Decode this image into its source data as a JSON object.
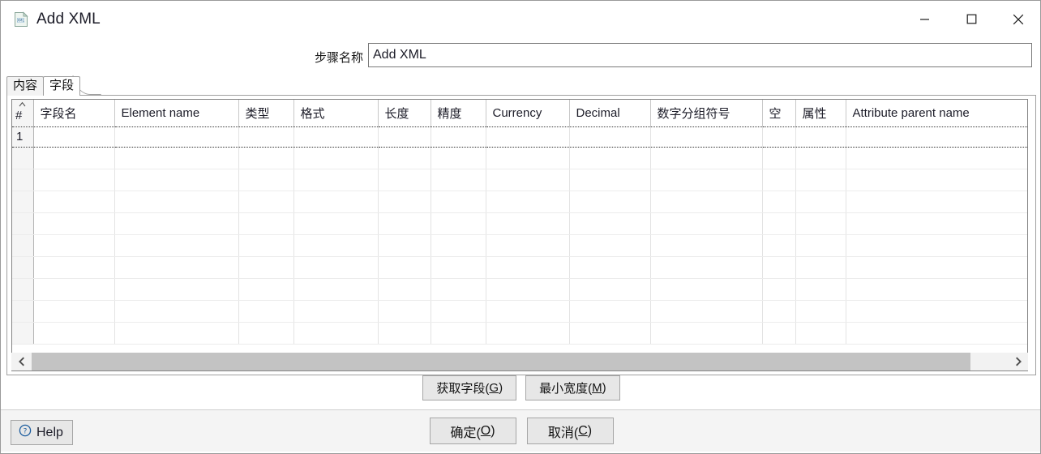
{
  "window": {
    "title": "Add XML",
    "icon": "xml-document-icon",
    "controls": {
      "minimize": "minimize-icon",
      "maximize": "maximize-icon",
      "close": "close-icon"
    }
  },
  "step_name": {
    "label": "步骤名称",
    "value": "Add XML",
    "placeholder": ""
  },
  "tabs": [
    {
      "label": "内容",
      "selected": false
    },
    {
      "label": "字段",
      "selected": true
    }
  ],
  "grid": {
    "columns": [
      {
        "key": "num",
        "label": "#",
        "sort": "ascending"
      },
      {
        "key": "fieldname",
        "label": "字段名"
      },
      {
        "key": "elementname",
        "label": "Element name"
      },
      {
        "key": "type",
        "label": "类型"
      },
      {
        "key": "format",
        "label": "格式"
      },
      {
        "key": "length",
        "label": "长度"
      },
      {
        "key": "precision",
        "label": "精度"
      },
      {
        "key": "currency",
        "label": "Currency"
      },
      {
        "key": "decimal",
        "label": "Decimal"
      },
      {
        "key": "grouping",
        "label": "数字分组符号"
      },
      {
        "key": "null",
        "label": "空"
      },
      {
        "key": "attribute",
        "label": "属性"
      },
      {
        "key": "attrparent",
        "label": "Attribute parent name"
      }
    ],
    "rows": [
      {
        "num": "1",
        "fieldname": "",
        "elementname": "",
        "type": "",
        "format": "",
        "length": "",
        "precision": "",
        "currency": "",
        "decimal": "",
        "grouping": "",
        "null": "",
        "attribute": "",
        "attrparent": ""
      }
    ],
    "empty_row_count": 9,
    "scrollbar": {
      "left_arrow": "chevron-left-icon",
      "right_arrow": "chevron-right-icon",
      "thumb_fraction": 0.962
    }
  },
  "mid_buttons": [
    {
      "label": "获取字段( G)",
      "mnemonic": "G",
      "text_before": "获取字段( ",
      "text_after": ")"
    },
    {
      "label": "最小宽度(M)",
      "mnemonic": "M",
      "text_before": "最小宽度(",
      "text_after": ")"
    }
  ],
  "bottom": {
    "help": {
      "label": "Help",
      "icon": "help-circle-icon"
    },
    "ok": {
      "text_before": "确定(",
      "mnemonic": "O",
      "text_after": ")"
    },
    "cancel": {
      "text_before": "取消(",
      "mnemonic": "C",
      "text_after": ")"
    }
  },
  "colors": {
    "window_bg": "#ffffff",
    "bottom_bar_bg": "#f4f4f4",
    "button_bg": "#e7e7e7",
    "border": "#a0a0a0",
    "scrollbar_thumb": "#c3c3c3",
    "row_header_bg": "#f5f5f5",
    "help_icon": "#1c5c9e"
  }
}
